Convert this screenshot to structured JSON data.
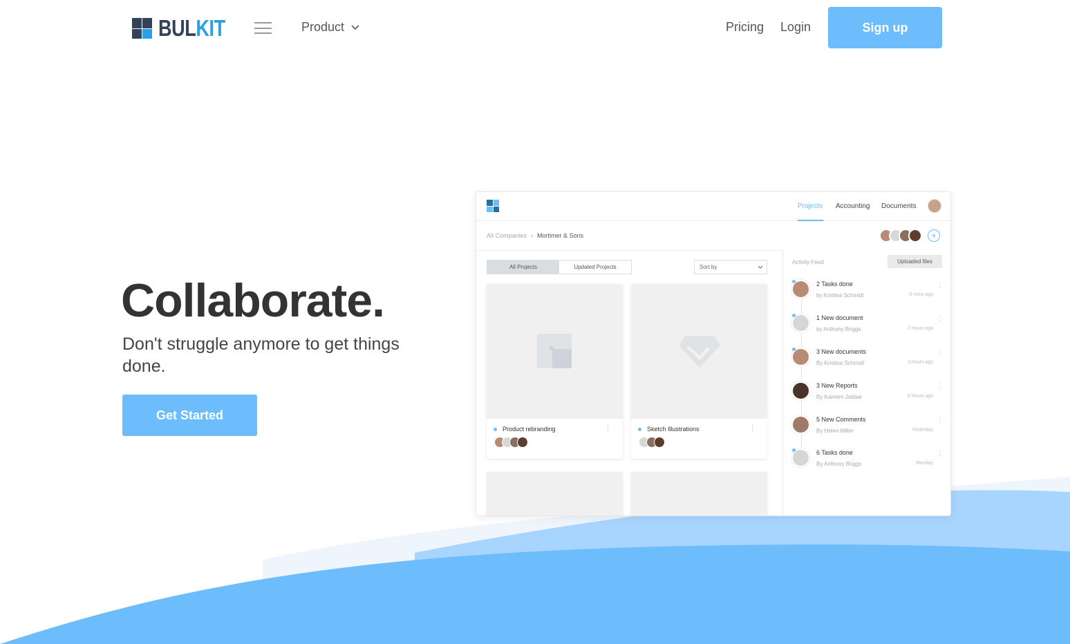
{
  "brand": {
    "word_part1": "BUL",
    "word_part2": "KIT",
    "colors": {
      "dark": "#344258",
      "blue": "#2a9fe5",
      "accent": "#6dbcfc"
    }
  },
  "nav": {
    "product_label": "Product",
    "pricing_label": "Pricing",
    "login_label": "Login",
    "signup_label": "Sign up"
  },
  "hero": {
    "title": "Collaborate.",
    "subtitle": "Don't struggle anymore to get things done.",
    "cta_label": "Get Started"
  },
  "mockup": {
    "tabs": [
      "Projects",
      "Accounting",
      "Documents"
    ],
    "active_tab": "Projects",
    "breadcrumb": {
      "root": "All Companies",
      "current": "Mortimer & Sons"
    },
    "filters": {
      "all": "All Projects",
      "updated": "Updated Projects",
      "sort": "Sort by"
    },
    "projects": [
      {
        "name": "Product rebranding",
        "icon": "image-placeholder-icon"
      },
      {
        "name": "Sketch Illustrations",
        "icon": "diamond-icon"
      }
    ],
    "feed": {
      "label": "Activity Feed",
      "uploaded_button": "Uploaded files",
      "items": [
        {
          "title": "2 Tasks done",
          "by": "by Kristina Schmidt",
          "time": "5 mins ago"
        },
        {
          "title": "1 New document",
          "by": "by Anthony Briggs",
          "time": "2 hours ago"
        },
        {
          "title": "3 New documents",
          "by": "By Kristina Schmidt",
          "time": "3 hours ago"
        },
        {
          "title": "3 New Reports",
          "by": "By Kareem Jabbar",
          "time": "8 hours ago"
        },
        {
          "title": "5 New Comments",
          "by": "By Helen Miller",
          "time": "Yesterday"
        },
        {
          "title": "6 Tasks done",
          "by": "By Anthony Briggs",
          "time": "Monday"
        }
      ]
    }
  }
}
